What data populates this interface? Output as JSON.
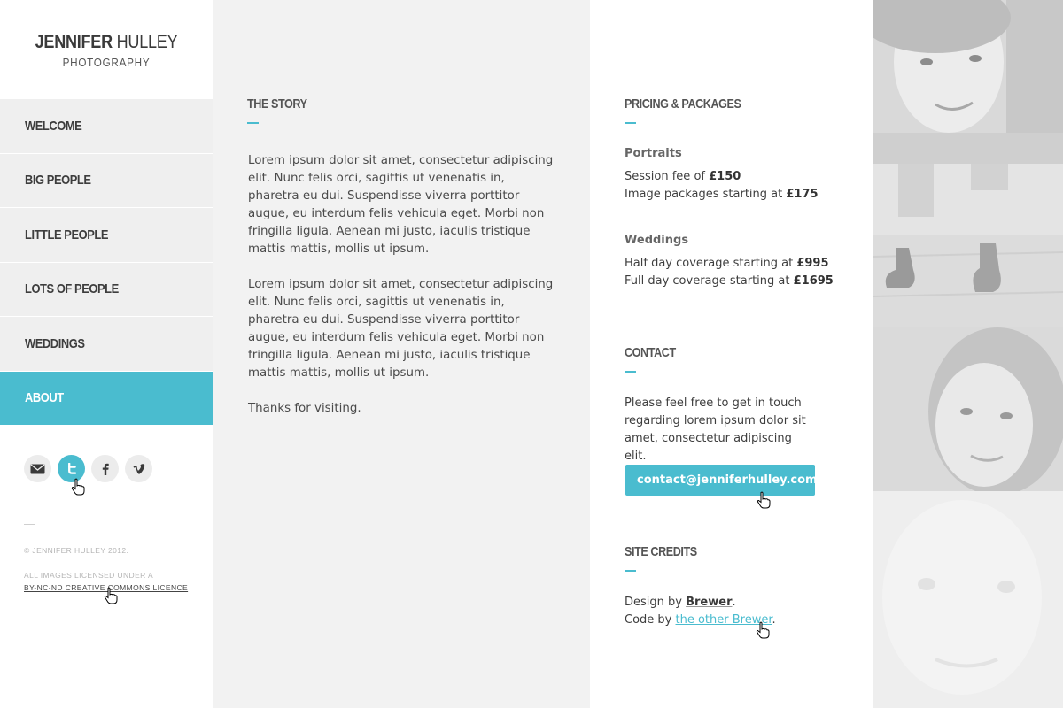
{
  "brand": {
    "first": "JENNIFER",
    "last": "HULLEY",
    "subtitle": "PHOTOGRAPHY"
  },
  "nav": [
    {
      "label": "WELCOME",
      "active": false
    },
    {
      "label": "BIG PEOPLE",
      "active": false
    },
    {
      "label": "LITTLE PEOPLE",
      "active": false
    },
    {
      "label": "LOTS OF PEOPLE",
      "active": false
    },
    {
      "label": "WEDDINGS",
      "active": false
    },
    {
      "label": "ABOUT",
      "active": true
    }
  ],
  "social": [
    {
      "icon": "mail-icon",
      "active": false
    },
    {
      "icon": "twitter-icon",
      "active": true
    },
    {
      "icon": "facebook-icon",
      "active": false
    },
    {
      "icon": "vimeo-icon",
      "active": false
    }
  ],
  "footer": {
    "dash": "—",
    "copyright": "© JENNIFER HULLEY 2012.",
    "licence_intro": "ALL IMAGES LICENSED UNDER A",
    "licence_link": "BY-NC-ND CREATIVE COMMONS LICENCE"
  },
  "story": {
    "title": "THE STORY",
    "paragraphs": [
      "Lorem ipsum dolor sit amet, consectetur adipiscing elit. Nunc felis orci, sagittis ut venenatis in, pharetra eu dui. Suspendisse viverra porttitor augue, eu interdum felis vehicula eget. Morbi non fringilla ligula. Aenean mi justo, iaculis tristique mattis mattis, mollis ut ipsum.",
      "Lorem ipsum dolor sit amet, consectetur adipiscing elit. Nunc felis orci, sagittis ut venenatis in, pharetra eu dui. Suspendisse viverra porttitor augue, eu interdum felis vehicula eget. Morbi non fringilla ligula. Aenean mi justo, iaculis tristique mattis mattis, mollis ut ipsum.",
      "Thanks for visiting."
    ]
  },
  "pricing": {
    "title": "PRICING & PACKAGES",
    "portraits": {
      "heading": "Portraits",
      "session_text": "Session fee of ",
      "session_price": "£150",
      "packages_text": "Image packages starting at ",
      "packages_price": "£175"
    },
    "weddings": {
      "heading": "Weddings",
      "half_text": "Half day coverage starting at ",
      "half_price": "£995",
      "full_text": "Full day coverage starting at ",
      "full_price": "£1695"
    }
  },
  "contact": {
    "title": "CONTACT",
    "text": "Please feel free to get in touch regarding lorem ipsum dolor sit amet, consectetur adipiscing elit.",
    "email": "contact@jenniferhulley.com"
  },
  "credits": {
    "title": "SITE CREDITS",
    "design_prefix": "Design by ",
    "design_name": "Brewer",
    "code_prefix": "Code by ",
    "code_name": "the other Brewer",
    "end": "."
  },
  "colors": {
    "accent": "#4abccf",
    "nav_bg": "#efefef",
    "story_bg": "#f2f2f2"
  }
}
